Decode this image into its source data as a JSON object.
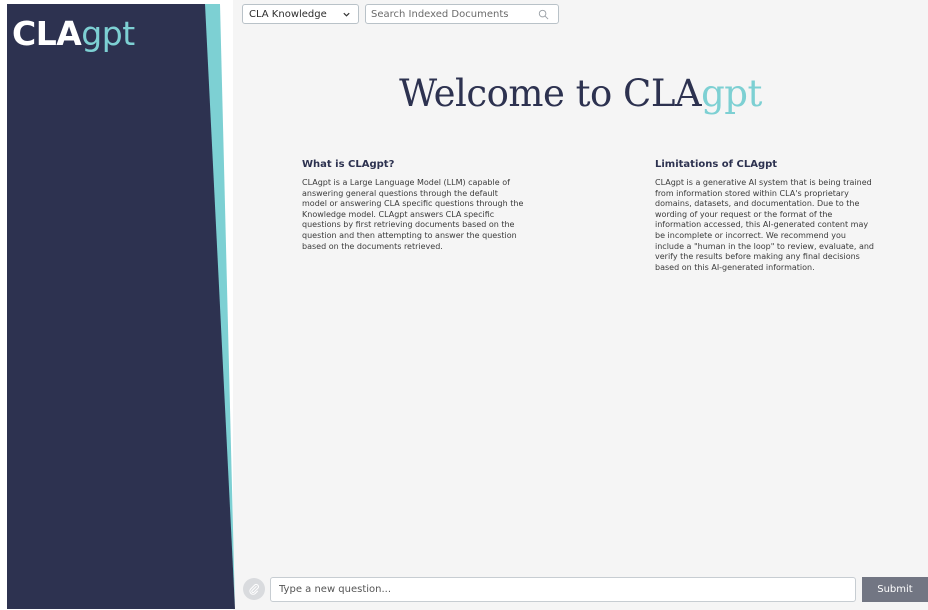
{
  "brand": {
    "logo_cla": "CLA",
    "logo_gpt": "gpt",
    "colors": {
      "navy": "#2d3250",
      "teal": "#7dd0d3",
      "background": "#f5f5f5",
      "submit": "#727683"
    }
  },
  "topbar": {
    "knowledge_select": {
      "selected": "CLA Knowledge",
      "icon": "chevron-down-icon"
    },
    "search": {
      "placeholder": "Search Indexed Documents",
      "value": "",
      "icon": "search-icon"
    }
  },
  "welcome": {
    "prefix": "Welcome to CLA",
    "suffix": "gpt"
  },
  "sections": {
    "about": {
      "title": "What is CLAgpt?",
      "body": "CLAgpt is a Large Language Model (LLM) capable of answering general questions through the default model or answering CLA specific questions through the Knowledge model. CLAgpt answers CLA specific questions by first retrieving documents based on the question and then attempting to answer the question based on the documents retrieved."
    },
    "limitations": {
      "title": "Limitations of CLAgpt",
      "body": "CLAgpt is a generative AI system that is being trained from information stored within CLA's proprietary domains, datasets, and documentation. Due to the wording of your request or the format of the information accessed, this AI-generated content may be incomplete or incorrect. We recommend you include a \"human in the loop\" to review, evaluate, and verify the results before making any final decisions based on this AI-generated information."
    }
  },
  "composer": {
    "attach_icon": "attach-icon",
    "placeholder": "Type a new question...",
    "value": "",
    "submit_label": "Submit"
  }
}
